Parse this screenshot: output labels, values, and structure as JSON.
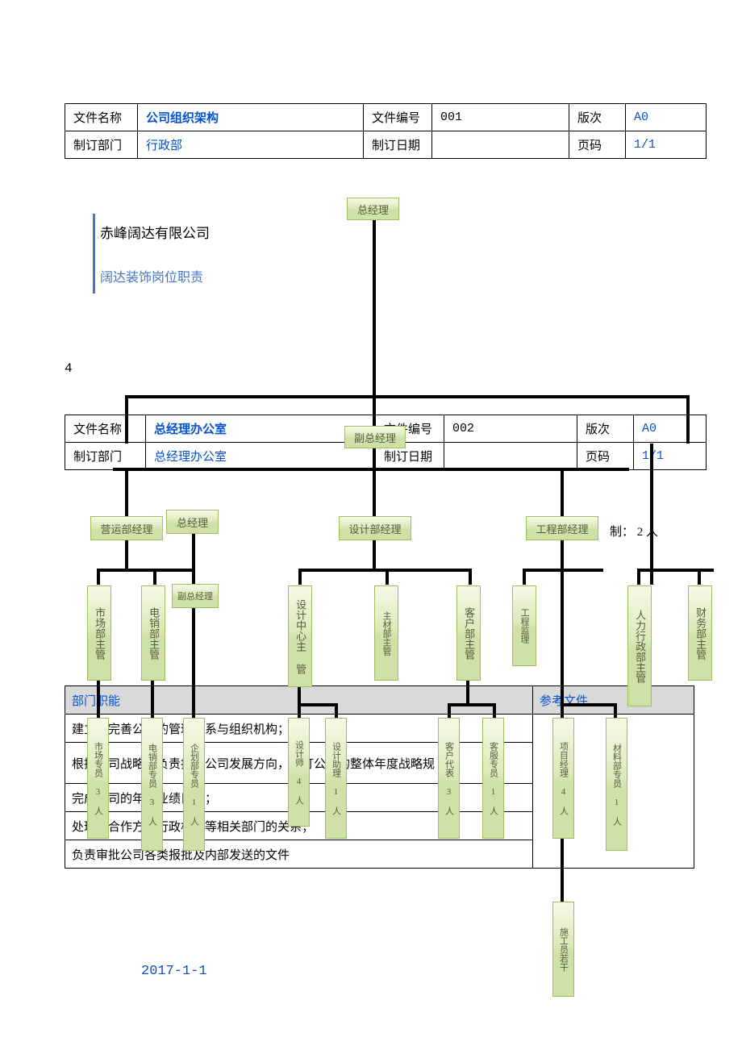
{
  "header1": {
    "c1": "文件名称",
    "v1": "公司组织架构",
    "c2": "文件编号",
    "v2": "001",
    "c3": "版次",
    "v3": "A0",
    "c4": "制订部门",
    "v4": "行政部",
    "c5": "制订日期",
    "v5": "",
    "c6": "页码",
    "v6": "1/1"
  },
  "company": {
    "name": "赤峰阔达有限公司",
    "subtitle": "阔达装饰岗位职责"
  },
  "page_marker": "4",
  "header2": {
    "c1": "文件名称",
    "v1": "总经理办公室",
    "c2": "文件编号",
    "v2": "002",
    "c3": "版次",
    "v3": "A0",
    "c4": "制订部门",
    "v4": "总经理办公室",
    "c5": "制订日期",
    "v5": "",
    "c6": "页码",
    "v6": "1/1"
  },
  "org": {
    "top": "总经理",
    "vice": "副总经理",
    "ops_mgr": "营运部经理",
    "gm2": "总经理",
    "design_mgr": "设计部经理",
    "eng_mgr": "工程部经理",
    "vice2": "副总经理",
    "ctrl_label": "制：  2 人",
    "market_sup": "市场部主管",
    "tele_sup": "电销部主管",
    "design_center": "设计中心主 管",
    "material_sup": "主材部主管",
    "cust_sup": "客户部主管",
    "eng_sup": "工程监理",
    "hr_sup": "人力行政部主管",
    "fin_sup": "财务部主管",
    "market_spec": "市场专员 3 人",
    "tele_spec": "电销部专员 3 人",
    "plan_spec": "企划部专员 1 人",
    "designer": "设计师 4 人",
    "design_asst": "设计助理 1 人",
    "cust_rep": "客户代表 3 人",
    "cust_serv": "客服专员 1 人",
    "proj_mgr": "项目经理 4 人",
    "material_spec": "材料部专员 1 人",
    "construction": "施工员若干"
  },
  "dept": {
    "func_label": "部门职能",
    "ref_label": "参考文件",
    "row1": "建立和完善公司的管理体系与组织机构；",
    "row2": "根据公司战略，负责指导公司发展方向，制订公司的整体年度战略规 划；",
    "row3": "完成公司的年度业绩目标；",
    "row4": "处理与合作方、行政机关等相关部门的关系；",
    "row5": "负责审批公司各类报批及内部发送的文件"
  },
  "footer_date": "2017-1-1"
}
